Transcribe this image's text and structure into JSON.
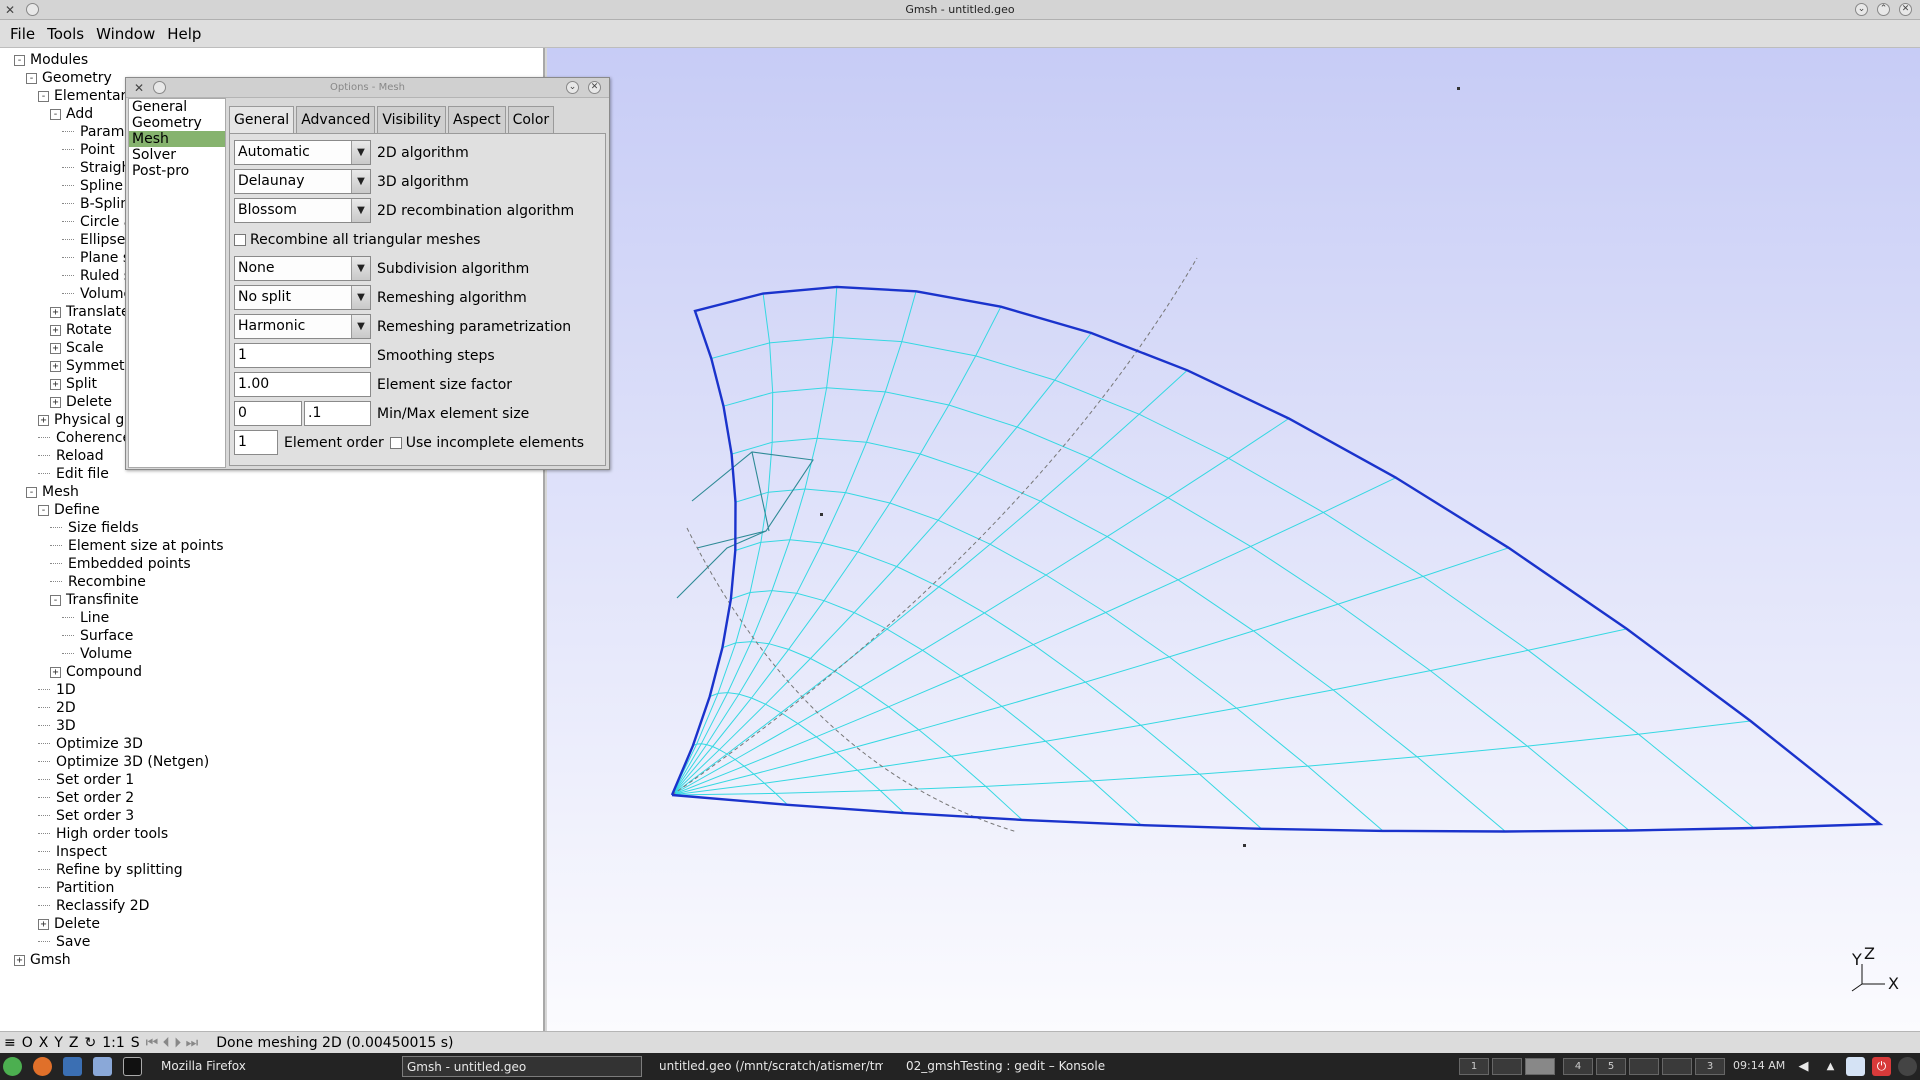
{
  "window": {
    "title": "Gmsh - untitled.geo"
  },
  "menu": [
    "File",
    "Tools",
    "Window",
    "Help"
  ],
  "tree": [
    {
      "label": "Modules",
      "depth": 0,
      "toggle": "-"
    },
    {
      "label": "Geometry",
      "depth": 1,
      "toggle": "-"
    },
    {
      "label": "Elementary entities",
      "depth": 2,
      "toggle": "-"
    },
    {
      "label": "Add",
      "depth": 3,
      "toggle": "-"
    },
    {
      "label": "Parameter",
      "depth": 4,
      "toggle": ""
    },
    {
      "label": "Point",
      "depth": 4,
      "toggle": ""
    },
    {
      "label": "Straight line",
      "depth": 4,
      "toggle": ""
    },
    {
      "label": "Spline",
      "depth": 4,
      "toggle": ""
    },
    {
      "label": "B-Spline",
      "depth": 4,
      "toggle": ""
    },
    {
      "label": "Circle arc",
      "depth": 4,
      "toggle": ""
    },
    {
      "label": "Ellipse arc",
      "depth": 4,
      "toggle": ""
    },
    {
      "label": "Plane surface",
      "depth": 4,
      "toggle": ""
    },
    {
      "label": "Ruled surface",
      "depth": 4,
      "toggle": ""
    },
    {
      "label": "Volume",
      "depth": 4,
      "toggle": ""
    },
    {
      "label": "Translate",
      "depth": 3,
      "toggle": "+"
    },
    {
      "label": "Rotate",
      "depth": 3,
      "toggle": "+"
    },
    {
      "label": "Scale",
      "depth": 3,
      "toggle": "+"
    },
    {
      "label": "Symmetry",
      "depth": 3,
      "toggle": "+"
    },
    {
      "label": "Split",
      "depth": 3,
      "toggle": "+"
    },
    {
      "label": "Delete",
      "depth": 3,
      "toggle": "+"
    },
    {
      "label": "Physical groups",
      "depth": 2,
      "toggle": "+"
    },
    {
      "label": "Coherence",
      "depth": 2,
      "toggle": ""
    },
    {
      "label": "Reload",
      "depth": 2,
      "toggle": ""
    },
    {
      "label": "Edit file",
      "depth": 2,
      "toggle": ""
    },
    {
      "label": "Mesh",
      "depth": 1,
      "toggle": "-"
    },
    {
      "label": "Define",
      "depth": 2,
      "toggle": "-"
    },
    {
      "label": "Size fields",
      "depth": 3,
      "toggle": ""
    },
    {
      "label": "Element size at points",
      "depth": 3,
      "toggle": ""
    },
    {
      "label": "Embedded points",
      "depth": 3,
      "toggle": ""
    },
    {
      "label": "Recombine",
      "depth": 3,
      "toggle": ""
    },
    {
      "label": "Transfinite",
      "depth": 3,
      "toggle": "-"
    },
    {
      "label": "Line",
      "depth": 4,
      "toggle": ""
    },
    {
      "label": "Surface",
      "depth": 4,
      "toggle": ""
    },
    {
      "label": "Volume",
      "depth": 4,
      "toggle": ""
    },
    {
      "label": "Compound",
      "depth": 3,
      "toggle": "+"
    },
    {
      "label": "1D",
      "depth": 2,
      "toggle": ""
    },
    {
      "label": "2D",
      "depth": 2,
      "toggle": ""
    },
    {
      "label": "3D",
      "depth": 2,
      "toggle": ""
    },
    {
      "label": "Optimize 3D",
      "depth": 2,
      "toggle": ""
    },
    {
      "label": "Optimize 3D (Netgen)",
      "depth": 2,
      "toggle": ""
    },
    {
      "label": "Set order 1",
      "depth": 2,
      "toggle": ""
    },
    {
      "label": "Set order 2",
      "depth": 2,
      "toggle": ""
    },
    {
      "label": "Set order 3",
      "depth": 2,
      "toggle": ""
    },
    {
      "label": "High order tools",
      "depth": 2,
      "toggle": ""
    },
    {
      "label": "Inspect",
      "depth": 2,
      "toggle": ""
    },
    {
      "label": "Refine by splitting",
      "depth": 2,
      "toggle": ""
    },
    {
      "label": "Partition",
      "depth": 2,
      "toggle": ""
    },
    {
      "label": "Reclassify 2D",
      "depth": 2,
      "toggle": ""
    },
    {
      "label": "Delete",
      "depth": 2,
      "toggle": "+"
    },
    {
      "label": "Save",
      "depth": 2,
      "toggle": ""
    },
    {
      "label": "Gmsh",
      "depth": 0,
      "toggle": "+"
    }
  ],
  "gear_button": {
    "icon": "gear-icon",
    "label": "⚙ ▽"
  },
  "dialog": {
    "title": "Options - Mesh",
    "categories": [
      "General",
      "Geometry",
      "Mesh",
      "Solver",
      "Post-pro"
    ],
    "selected_category": "Mesh",
    "tabs": [
      "General",
      "Advanced",
      "Visibility",
      "Aspect",
      "Color"
    ],
    "active_tab": "General",
    "alg2d": {
      "value": "Automatic",
      "label": "2D algorithm"
    },
    "alg3d": {
      "value": "Delaunay",
      "label": "3D algorithm"
    },
    "recomb_alg": {
      "value": "Blossom",
      "label": "2D recombination algorithm"
    },
    "recombine_all": {
      "label": "Recombine all triangular meshes",
      "checked": false
    },
    "subdivision": {
      "value": "None",
      "label": "Subdivision algorithm"
    },
    "remeshing": {
      "value": "No split",
      "label": "Remeshing algorithm"
    },
    "remesh_param": {
      "value": "Harmonic",
      "label": "Remeshing parametrization"
    },
    "smoothing": {
      "value": "1",
      "label": "Smoothing steps"
    },
    "size_factor": {
      "value": "1.00",
      "label": "Element size factor"
    },
    "minmax": {
      "min": "0",
      "max": ".1",
      "label": "Min/Max element size"
    },
    "order": {
      "value": "1",
      "label": "Element order"
    },
    "incomplete": {
      "label": "Use incomplete elements",
      "checked": false
    }
  },
  "axes": {
    "y": "Y",
    "z": "Z",
    "x": "X"
  },
  "status": {
    "buttons": [
      "≡",
      "O",
      "X",
      "Y",
      "Z",
      "↻",
      "1:1",
      "S"
    ],
    "anim": "⏮ ⏴ ⏵ ⏭",
    "message": "Done meshing 2D (0.00450015 s)"
  },
  "taskbar": {
    "tasks": [
      {
        "label": "Mozilla Firefox",
        "active": false
      },
      {
        "label": "Gmsh - untitled.geo",
        "active": true
      },
      {
        "label": "untitled.geo (/mnt/scratch/atismer/tmp/",
        "active": false
      },
      {
        "label": "02_gmshTesting : gedit – Konsole",
        "active": false
      }
    ],
    "desktops": [
      "1",
      "",
      "",
      "4",
      "5",
      "",
      "",
      "3"
    ],
    "clock": "09:14 AM"
  },
  "colors": {
    "mesh_line": "#35d8e2",
    "boundary": "#1a33cc",
    "selected_category": "#86b36e"
  }
}
